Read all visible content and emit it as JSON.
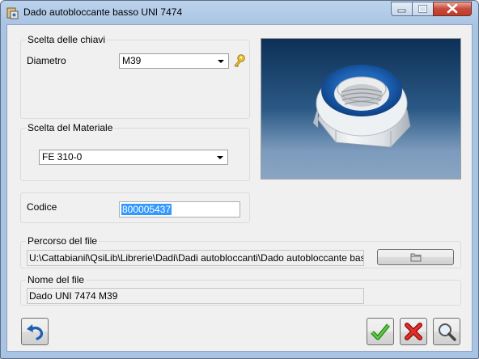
{
  "window": {
    "title": "Dado autobloccante basso UNI 7474"
  },
  "keys_group": {
    "legend": "Scelta delle chiavi",
    "diameter_label": "Diametro",
    "diameter_value": "M39"
  },
  "material_group": {
    "legend": "Scelta del Materiale",
    "material_value": "FE 310-0"
  },
  "code": {
    "label": "Codice",
    "value": "800005437"
  },
  "file_path": {
    "legend": "Percorso del file",
    "value": "U:\\Cattabianil\\QsiLib\\Librerie\\Dadi\\Dadi autobloccanti\\Dado autobloccante basso UN"
  },
  "file_name": {
    "legend": "Nome del file",
    "value": "Dado UNI 7474 M39"
  },
  "colors": {
    "accent": "#3399ff",
    "ok": "#2a9d2a",
    "cancel": "#d11a1a",
    "preview_bg": "#2a5985"
  },
  "icons": {
    "app": "nut-app-icon",
    "key": "key-icon",
    "folder": "folder-icon",
    "undo": "undo-icon",
    "ok": "checkmark-icon",
    "cancel": "x-icon",
    "search": "magnifier-icon"
  }
}
